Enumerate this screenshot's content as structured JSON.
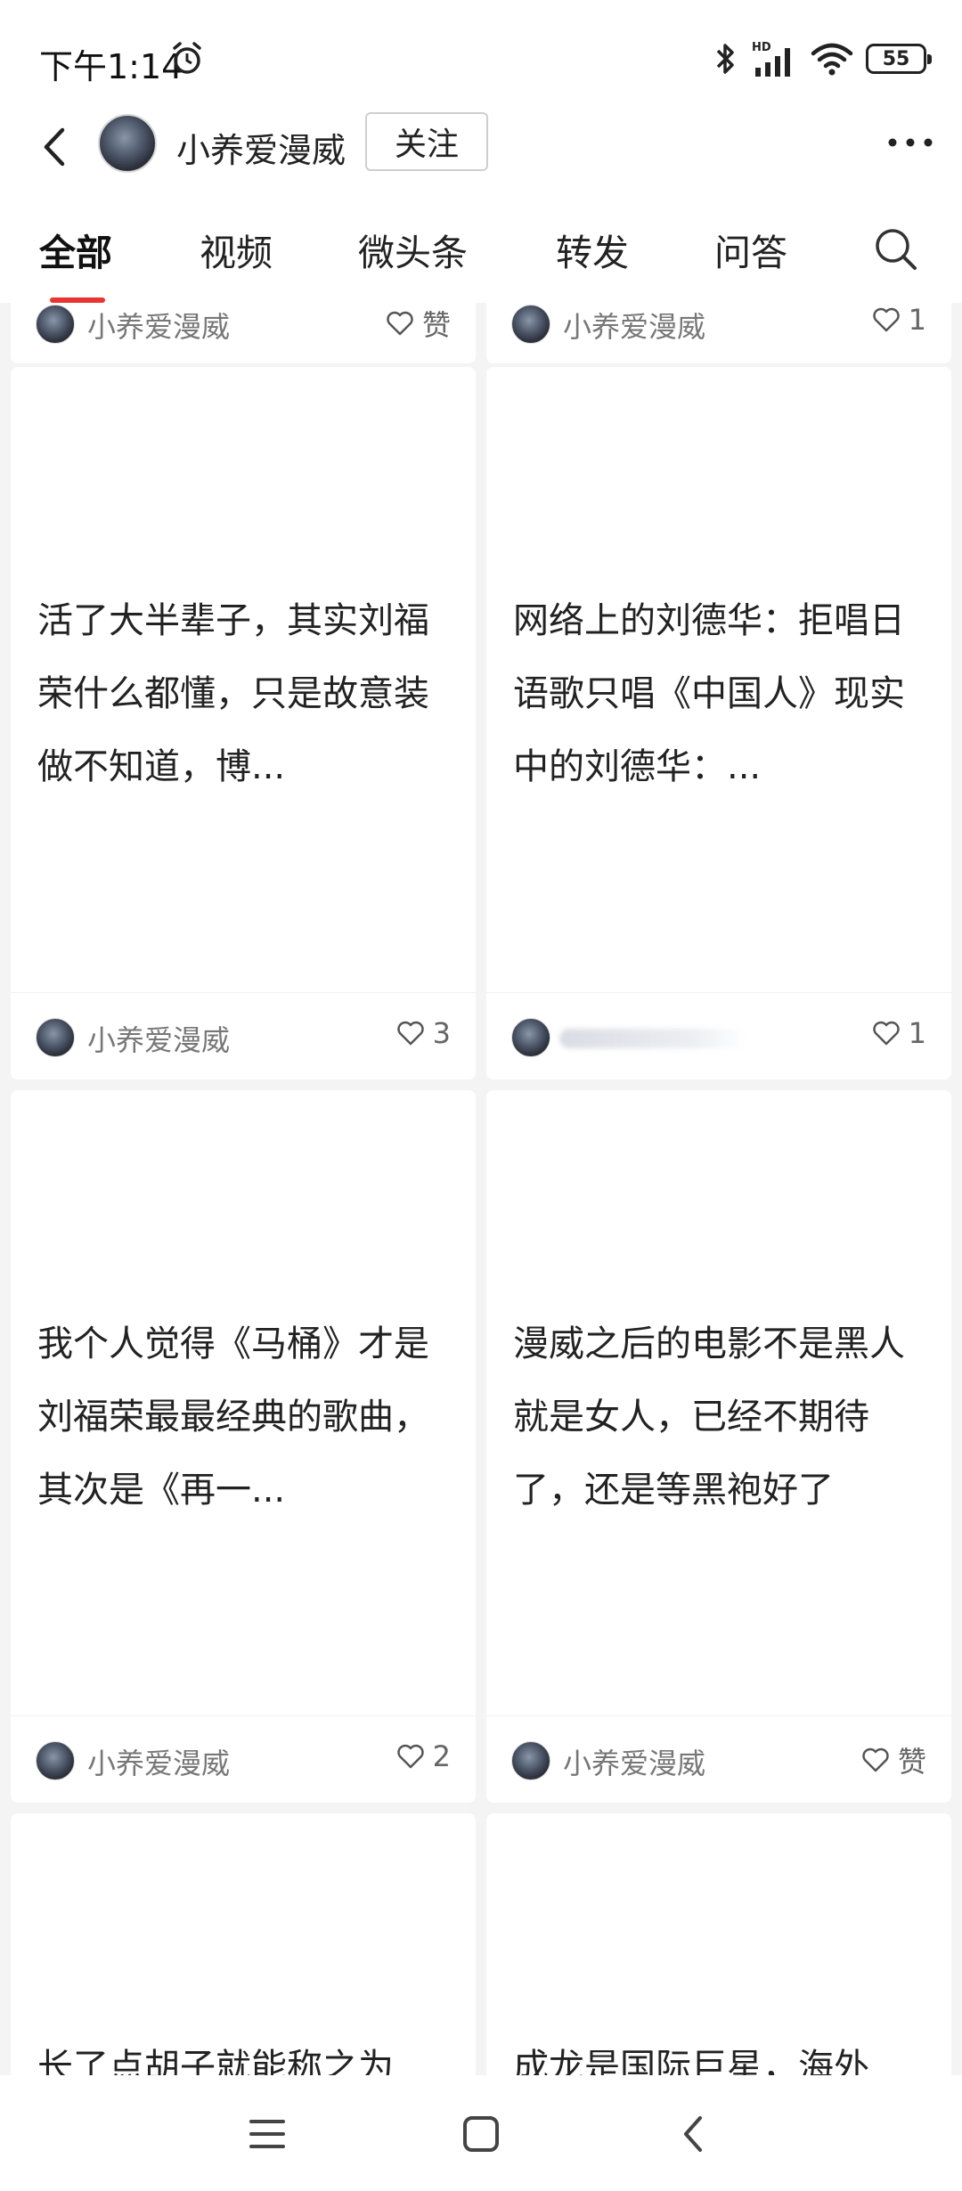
{
  "status_bar": {
    "time": "下午1:14",
    "battery": "55",
    "network_label": "HD"
  },
  "header": {
    "account_name": "小养爱漫威",
    "follow_label": "关注"
  },
  "tabs": [
    {
      "label": "全部",
      "active": true
    },
    {
      "label": "视频",
      "active": false
    },
    {
      "label": "微头条",
      "active": false
    },
    {
      "label": "转发",
      "active": false
    },
    {
      "label": "问答",
      "active": false
    }
  ],
  "partial_top_cards": [
    {
      "author": "小养爱漫威",
      "likes": "赞"
    },
    {
      "author": "小养爱漫威",
      "likes": "1"
    }
  ],
  "cards": [
    {
      "text": "活了大半辈子，其实刘福荣什么都懂，只是故意装做不知道，博...",
      "author": "小养爱漫威",
      "likes": "3"
    },
    {
      "text": "网络上的刘德华：拒唱日语歌只唱《中国人》现实中的刘德华：...",
      "author": "",
      "likes": "1"
    },
    {
      "text": "我个人觉得《马桶》才是刘福荣最最经典的歌曲，其次是《再一...",
      "author": "小养爱漫威",
      "likes": "2"
    },
    {
      "text": "漫威之后的电影不是黑人就是女人，已经不期待了，还是等黑袍好了",
      "author": "小养爱漫威",
      "likes": "赞"
    }
  ],
  "partial_bottom_cards": [
    {
      "text": "长了点胡子就能称之为"
    },
    {
      "text": "成龙是国际巨星，海外"
    }
  ],
  "colors": {
    "accent": "#e8352f",
    "background": "#f4f4f4"
  }
}
